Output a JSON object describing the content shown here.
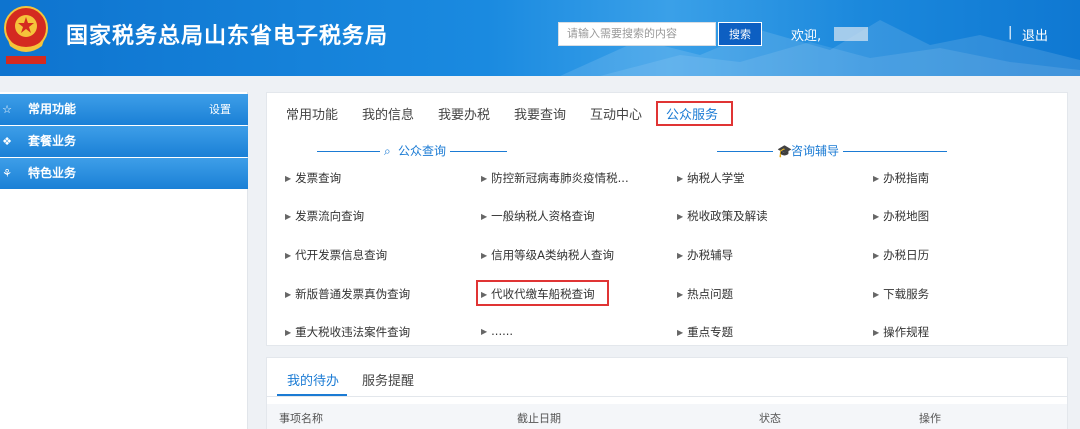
{
  "header": {
    "title": "国家税务总局山东省电子税务局",
    "search_placeholder": "请输入需要搜索的内容",
    "search_button": "搜索",
    "welcome": "欢迎,",
    "separator": "|",
    "logout": "退出",
    "emblem_icon": "tax-emblem-icon",
    "brand_color": "#1a85dc"
  },
  "sidebar": {
    "items": [
      {
        "icon": "☆",
        "label": "常用功能",
        "action": "设置"
      },
      {
        "icon": "❖",
        "label": "套餐业务"
      },
      {
        "icon": "⚘",
        "label": "特色业务"
      }
    ]
  },
  "services": {
    "tabs": [
      "常用功能",
      "我的信息",
      "我要办税",
      "我要查询",
      "互动中心",
      "公众服务"
    ],
    "active_tab": "公众服务",
    "sections": {
      "left_title": "公众查询",
      "right_title": "咨询辅导"
    },
    "grid": [
      [
        "发票查询",
        "防控新冠病毒肺炎疫情税...",
        "纳税人学堂",
        "办税指南"
      ],
      [
        "发票流向查询",
        "一般纳税人资格查询",
        "税收政策及解读",
        "办税地图"
      ],
      [
        "代开发票信息查询",
        "信用等级A类纳税人查询",
        "办税辅导",
        "办税日历"
      ],
      [
        "新版普通发票真伪查询",
        "代收代缴车船税查询",
        "热点问题",
        "下载服务"
      ],
      [
        "重大税收违法案件查询",
        "......",
        "重点专题",
        "操作规程"
      ]
    ],
    "highlight_color": "#e03434",
    "accent_color": "#1b7bd4"
  },
  "todo": {
    "tabs": [
      "我的待办",
      "服务提醒"
    ],
    "columns": [
      "事项名称",
      "截止日期",
      "状态",
      "操作"
    ]
  }
}
